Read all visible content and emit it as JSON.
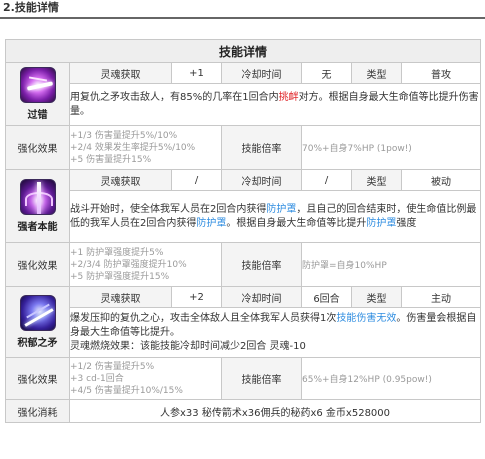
{
  "section": {
    "title": "2.技能详情"
  },
  "table": {
    "header": "技能详情",
    "labels": {
      "soul_gain": "灵魂获取",
      "cooldown": "冷却时间",
      "type": "类型",
      "enhance_effect": "强化效果",
      "skill_multiplier": "技能倍率",
      "enhance_cost": "强化消耗"
    },
    "skills": [
      {
        "name": "过错",
        "icon": "slash-icon",
        "soul_gain": "+1",
        "cooldown": "无",
        "type": "普攻",
        "desc_parts": [
          "用复仇之矛攻击敌人，有85%的几率在1回合内",
          "挑衅",
          "对方。根据自身最大生命值等比提升伤害量。"
        ],
        "upgrades": [
          "+1/3 伤害量提升5%/10%",
          "+2/4 效果发生率提升5%/10%",
          "+5 伤害量提升15%"
        ],
        "multiplier": "70%+自身7%HP (1pow!)"
      },
      {
        "name": "强者本能",
        "icon": "shield-pillar-icon",
        "soul_gain": "/",
        "cooldown": "/",
        "type": "被动",
        "desc_parts": [
          "战斗开始时，使全体我军人员在2回合内获得",
          "防护罩",
          "，且自己的回合结束时，使生命值比例最低的我军人员在2回合内获得",
          "防护罩",
          "。根据自身最大生命值等比提升",
          "防护罩",
          "强度"
        ],
        "upgrades": [
          "+1 防护罩强度提升5%",
          "+2/3/4 防护罩强度提升10%",
          "+5 防护罩强度提升15%"
        ],
        "multiplier": "防护罩=自身10%HP"
      },
      {
        "name": "积郁之矛",
        "icon": "spear-strike-icon",
        "soul_gain": "+2",
        "cooldown": "6回合",
        "type": "主动",
        "desc_parts": [
          "爆发压抑的复仇之心，攻击全体敌人且全体我军人员获得1次",
          "技能伤害无效",
          "。伤害量会根据自身最大生命值等比提升。",
          "灵魂燃烧效果：该能技能冷却时间减少2回合 灵魂-10"
        ],
        "upgrades": [
          "+1/2 伤害量提升5%",
          "+3 cd-1回合",
          "+4/5 伤害量提升10%/15%"
        ],
        "multiplier": "65%+自身12%HP (0.95pow!)"
      }
    ],
    "cost_text": "人参x33  秘传箭术x36佣兵的秘药x6 金币x528000"
  },
  "colors": {
    "highlight_red": "#e0262a",
    "highlight_blue": "#2f8de0",
    "muted_gray": "#9a9a9a"
  }
}
